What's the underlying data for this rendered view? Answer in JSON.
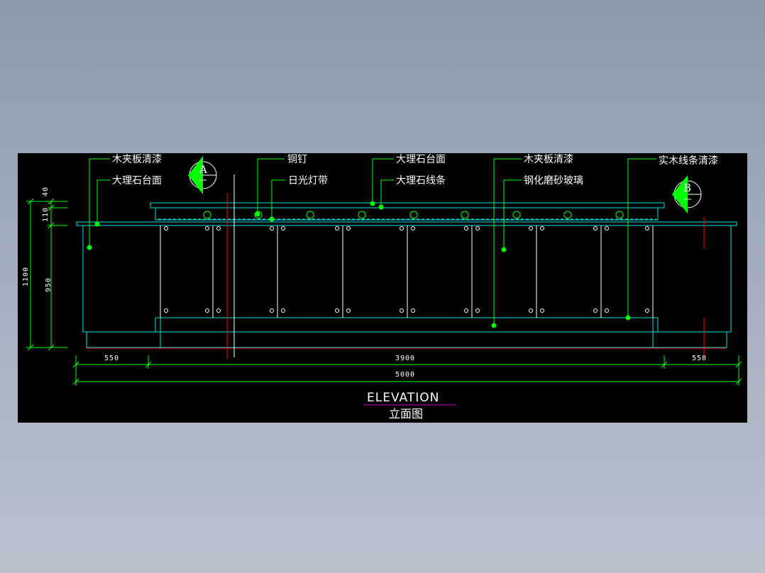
{
  "drawing": {
    "title": "ELEVATION",
    "subtitle": "立面图",
    "section_markers": {
      "a": "A",
      "b": "B"
    },
    "labels": {
      "wood_veneer_left": "木夹板清漆",
      "marble_top_left": "大理石台面",
      "copper_nail": "铜钉",
      "fluorescent_strip": "日光灯带",
      "marble_top_center": "大理石台面",
      "marble_molding": "大理石线条",
      "wood_veneer_right": "木夹板清漆",
      "frosted_glass": "钢化磨砂玻璃",
      "solid_wood_trim": "实木线条清漆"
    },
    "dimensions": {
      "h_left": "550",
      "h_center": "3900",
      "h_right": "550",
      "h_total": "5000",
      "v_top": "40",
      "v_second": "110",
      "v_main": "950",
      "v_total": "1100"
    },
    "colors": {
      "background": "#000000",
      "outline": "#00e5e5",
      "leader": "#00ff00",
      "dimension": "#00ff00",
      "text": "#ffffff",
      "section_cut": "#ff0000",
      "title_underline": "#d000d0"
    }
  }
}
